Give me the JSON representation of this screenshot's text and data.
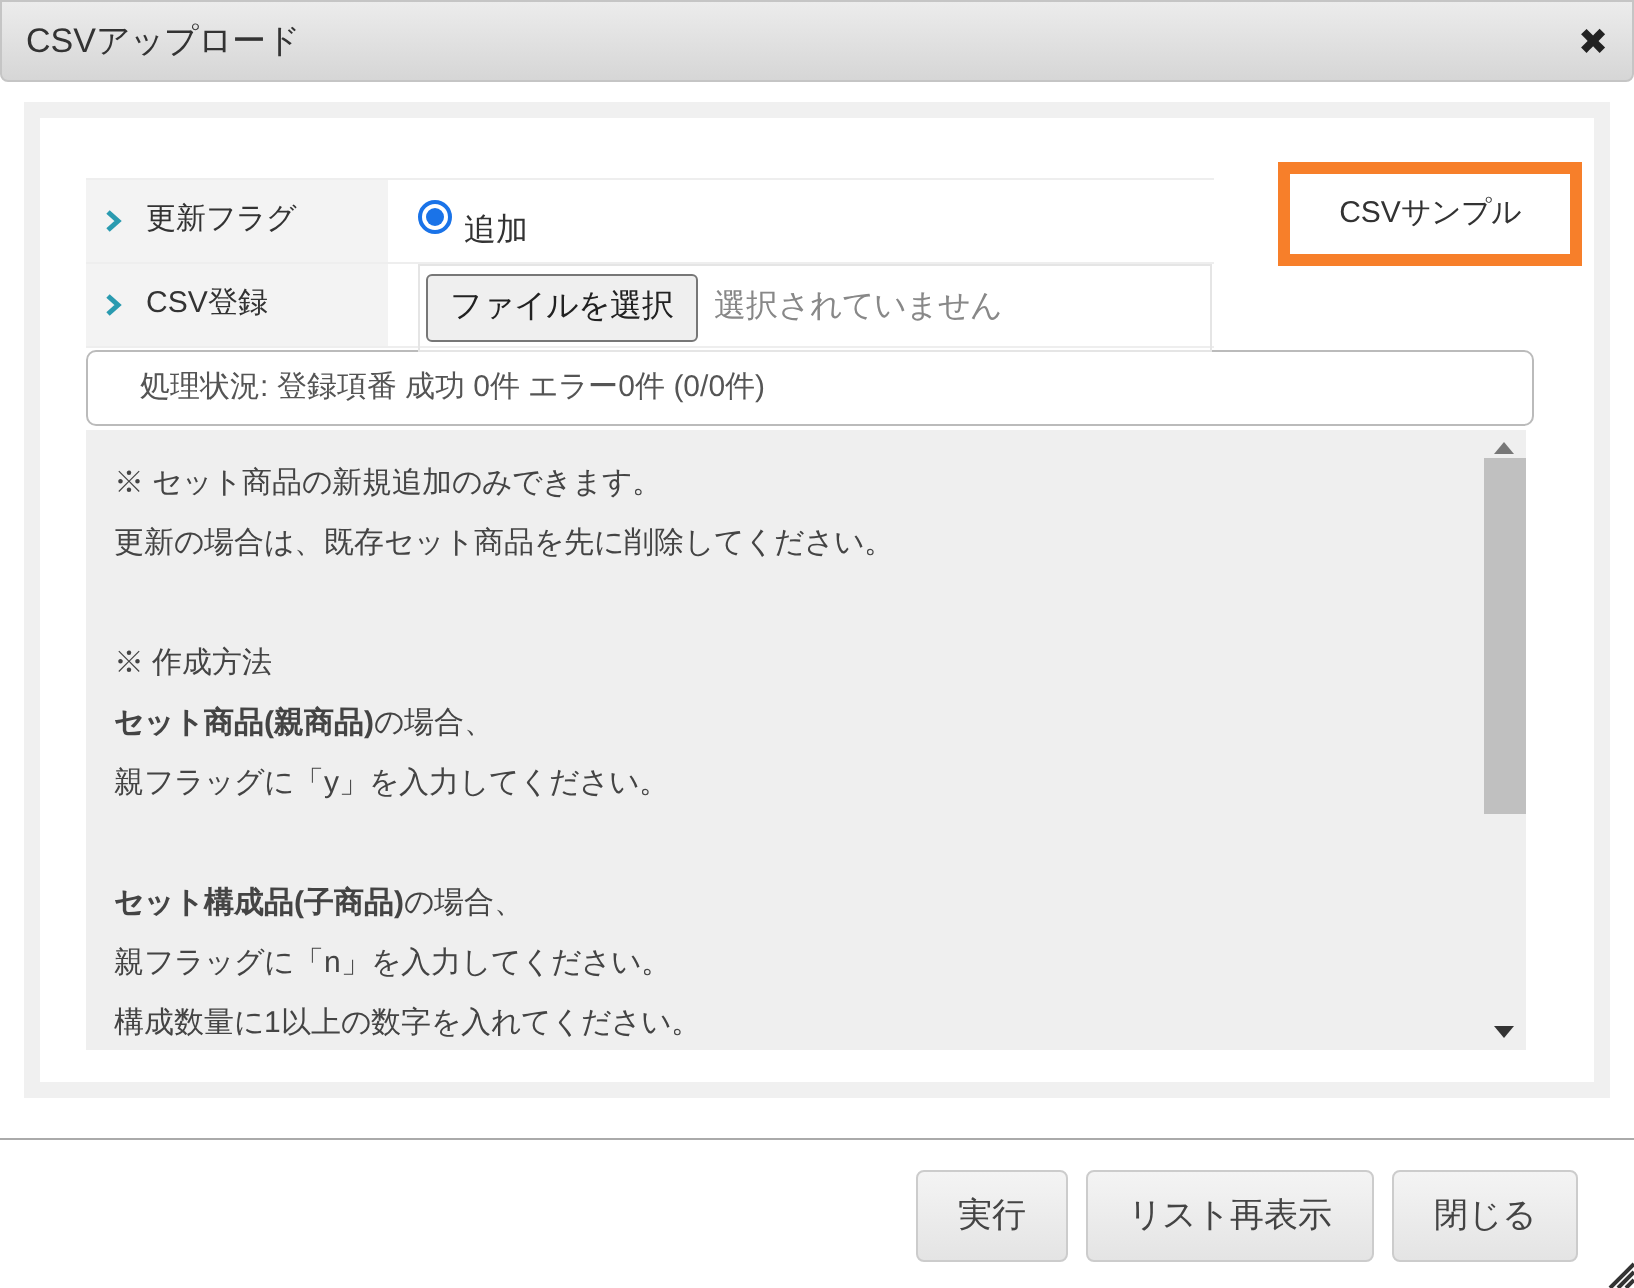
{
  "window": {
    "title": "CSVアップロード",
    "close": "✖"
  },
  "form": {
    "rows": [
      {
        "kind": "radio",
        "label": "更新フラグ",
        "option": {
          "label": "追加",
          "selected": true
        }
      },
      {
        "kind": "file",
        "label": "CSV登録",
        "button": "ファイルを選択",
        "value": "選択されていません"
      }
    ],
    "sample_button": "CSVサンプル"
  },
  "status": "処理状況: 登録項番 成功 0件 エラー0件 (0/0件)",
  "notes": [
    [
      "※ セット商品の新規追加のみできます。",
      "更新の場合は、既存セット商品を先に削除してください。"
    ],
    [
      "※ 作成方法",
      "**セット商品(親商品)**の場合、",
      "親フラッグに「y」を入力してください。"
    ],
    [
      "**セット構成品(子商品)**の場合、",
      "親フラッグに「n」を入力してください。",
      "構成数量に1以上の数字を入れてください。"
    ]
  ],
  "buttons": [
    "実行",
    "リスト再表示",
    "閉じる"
  ]
}
